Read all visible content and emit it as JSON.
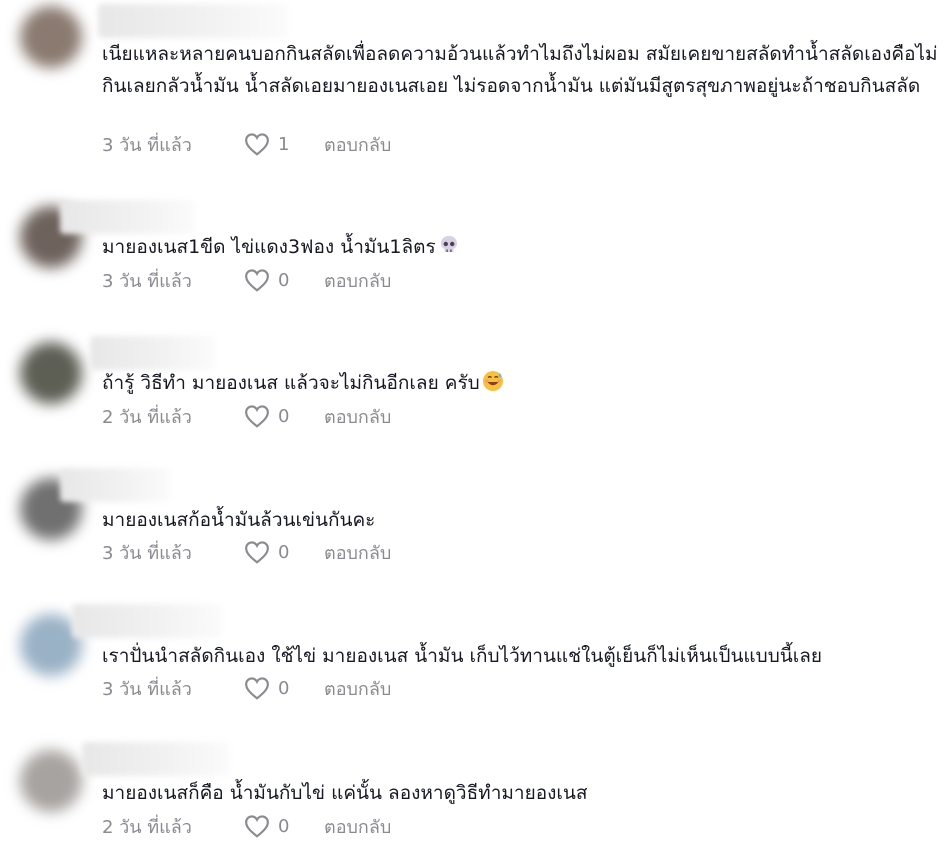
{
  "comments": [
    {
      "text": "เนียแหละหลายคนบอกกินสลัดเพื่อลดความอ้วนแล้วทำไมถึงไม่ผอม สมัยเคยขายสลัดทำน้ำสลัดเองคือไม่กินเลยกลัวน้ำมัน น้ำสลัดเอยมายองเนสเอย ไม่รอดจากน้ำมัน แต่มันมีสูตรสุขภาพอยู่นะถ้าชอบกินสลัด",
      "time": "3 วัน ที่แล้ว",
      "likes": "1",
      "reply": "ตอบกลับ",
      "emoji": "",
      "avatar_color": "#8a7a70"
    },
    {
      "text": "มายองเนส1ขีด ไข่แดง3ฟอง น้ำมัน1ลิตร",
      "time": "3 วัน ที่แล้ว",
      "likes": "0",
      "reply": "ตอบกลับ",
      "emoji": "skull-emoji",
      "avatar_color": "#6e625c"
    },
    {
      "text": "ถ้ารู้ วิธีทำ มายองเนส แล้วจะไม่กินอีกเลย ครับ",
      "time": "2 วัน ที่แล้ว",
      "likes": "0",
      "reply": "ตอบกลับ",
      "emoji": "sweat-smile-emoji",
      "avatar_color": "#5d5f55"
    },
    {
      "text": "มายองเนสก้อน้ำมันล้วนเข่นกันคะ",
      "time": "3 วัน ที่แล้ว",
      "likes": "0",
      "reply": "ตอบกลับ",
      "emoji": "",
      "avatar_color": "#707070"
    },
    {
      "text": "เราปั่นนำสลัดกินเอง ใช้ไข่ มายองเนส น้ำมัน เก็บไว้ทานแช่ในตู้เย็นก็ไม่เห็นเป็นแบบนี้เลย",
      "time": "3 วัน ที่แล้ว",
      "likes": "0",
      "reply": "ตอบกลับ",
      "emoji": "",
      "avatar_color": "#9ab2c6"
    },
    {
      "text": "มายองเนสก็คือ น้ำมันกับไข่ แค่นั้น ลองหาดูวิธีทำมายองเนส",
      "time": "2 วัน ที่แล้ว",
      "likes": "0",
      "reply": "ตอบกลับ",
      "emoji": "",
      "avatar_color": "#a7a3a0"
    }
  ]
}
